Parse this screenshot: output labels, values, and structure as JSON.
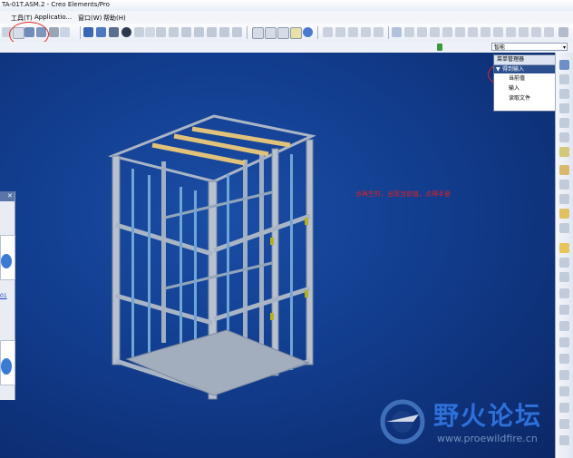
{
  "window": {
    "title": "TA-01T.ASM.2 - Creo Elements/Pro"
  },
  "menu": [
    {
      "label": "工具(T)"
    },
    {
      "label": "Applicatio..."
    },
    {
      "label": "窗口(W)"
    },
    {
      "label": "帮助(H)"
    }
  ],
  "status": {
    "filter_value": "智能"
  },
  "menu_manager": {
    "title": "菜单管理器",
    "selected": "得到输入",
    "items": [
      "当前值",
      "输入",
      "读取文件"
    ]
  },
  "annotation": {
    "text": "点再生时，出现当前值，点得手册"
  },
  "left_panel": {
    "link_text": "01"
  },
  "watermark": {
    "title": "野火论坛",
    "url": "www.proewildfire.cn"
  },
  "colors": {
    "background": "#0f2f73",
    "annotation": "#e41f1f",
    "frame": "#a8b4c4",
    "bar_accent": "#e0c27a",
    "bracket": "#b4b020"
  }
}
